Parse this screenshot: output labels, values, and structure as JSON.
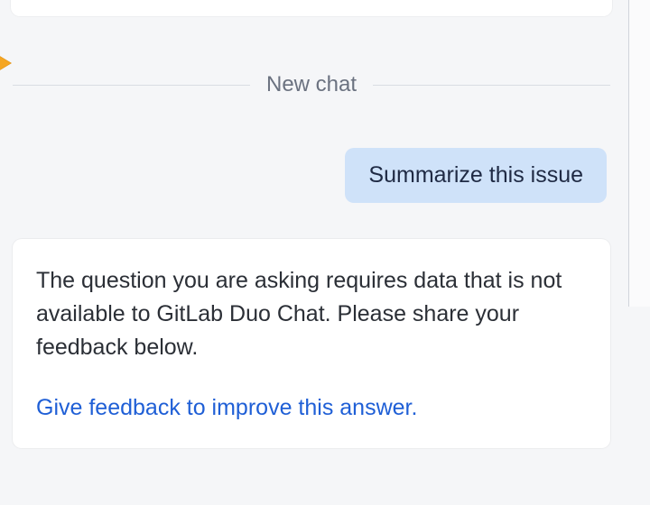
{
  "divider": {
    "label": "New chat"
  },
  "user_message": {
    "text": "Summarize this issue"
  },
  "assistant_message": {
    "text": "The question you are asking requires data that is not available to GitLab Duo Chat. Please share your feedback below.",
    "feedback_link": "Give feedback to improve this answer."
  }
}
